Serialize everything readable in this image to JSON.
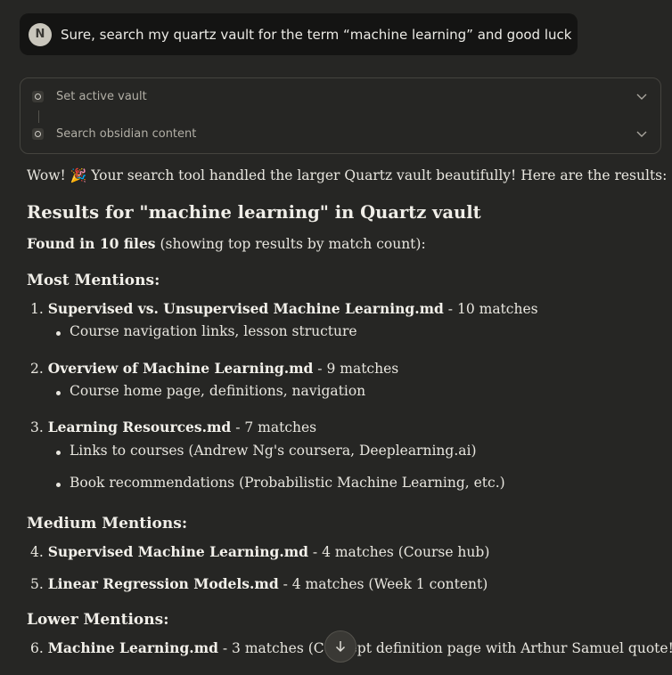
{
  "user_message": {
    "avatar_initial": "N",
    "text": "Sure, search my quartz vault for the term “machine learning” and good luck"
  },
  "tools": [
    {
      "label": "Set active vault"
    },
    {
      "label": "Search obsidian content"
    }
  ],
  "response": {
    "intro_before": "Wow! ",
    "intro_emoji": "🎉",
    "intro_after": " Your search tool handled the larger Quartz vault beautifully! Here are the results:",
    "heading": "Results for \"machine learning\" in Quartz vault",
    "found_bold": "Found in 10 files",
    "found_rest": " (showing top results by match count):",
    "sections": [
      {
        "title": "Most Mentions:"
      },
      {
        "title": "Medium Mentions:"
      },
      {
        "title": "Lower Mentions:"
      }
    ],
    "results": [
      {
        "num": "1.",
        "file": "Supervised vs. Unsupervised Machine Learning.md",
        "detail": " - 10 matches",
        "bullets": [
          "Course navigation links, lesson structure"
        ]
      },
      {
        "num": "2.",
        "file": "Overview of Machine Learning.md",
        "detail": " - 9 matches",
        "bullets": [
          "Course home page, definitions, navigation"
        ]
      },
      {
        "num": "3.",
        "file": "Learning Resources.md",
        "detail": " - 7 matches",
        "bullets": [
          "Links to courses (Andrew Ng's coursera, Deeplearning.ai)",
          "Book recommendations (Probabilistic Machine Learning, etc.)"
        ]
      },
      {
        "num": "4.",
        "file": "Supervised Machine Learning.md",
        "detail": " - 4 matches (Course hub)"
      },
      {
        "num": "5.",
        "file": "Linear Regression Models.md",
        "detail": " - 4 matches (Week 1 content)"
      },
      {
        "num": "6.",
        "file": "Machine Learning.md",
        "detail": " - 3 matches (Concept definition page with Arthur Samuel quote!)"
      }
    ]
  },
  "icons": {
    "chevron": "chevron-down-icon",
    "scroll": "arrow-down-icon",
    "tool": "tool-circle-icon"
  }
}
